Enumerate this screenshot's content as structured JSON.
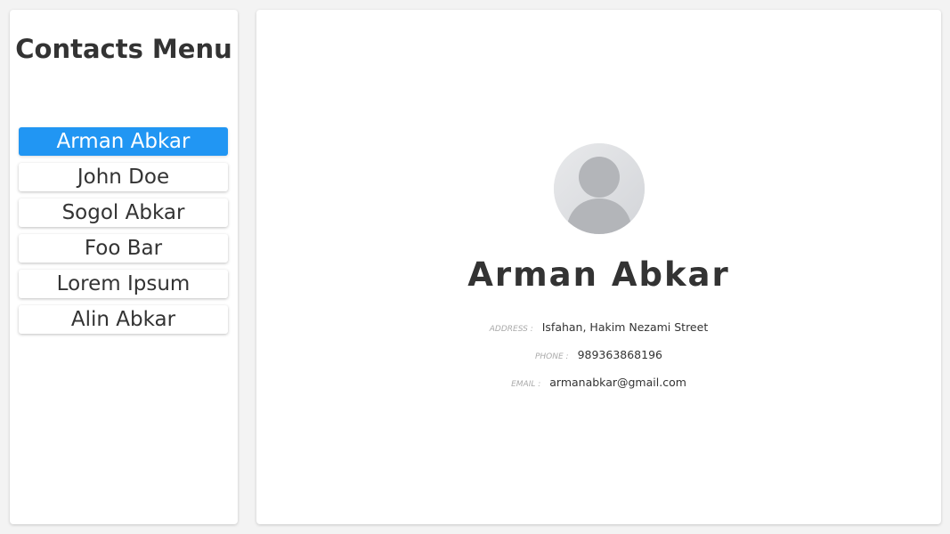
{
  "sidebar": {
    "title": "Contacts Menu",
    "contacts": [
      {
        "name": "Arman Abkar",
        "active": true
      },
      {
        "name": "John Doe",
        "active": false
      },
      {
        "name": "Sogol Abkar",
        "active": false
      },
      {
        "name": "Foo Bar",
        "active": false
      },
      {
        "name": "Lorem Ipsum",
        "active": false
      },
      {
        "name": "Alin Abkar",
        "active": false
      }
    ]
  },
  "profile": {
    "avatar_icon": "user-avatar-icon",
    "name": "Arman Abkar",
    "address_label": "ADDRESS :",
    "address": "Isfahan, Hakim Nezami Street",
    "phone_label": "PHONE :",
    "phone": "989363868196",
    "email_label": "EMAIL :",
    "email": "armanabkar@gmail.com"
  },
  "colors": {
    "accent": "#2196f3",
    "background": "#f3f3f3",
    "panel": "#ffffff",
    "text": "#333333",
    "label": "#aaaaaa"
  }
}
